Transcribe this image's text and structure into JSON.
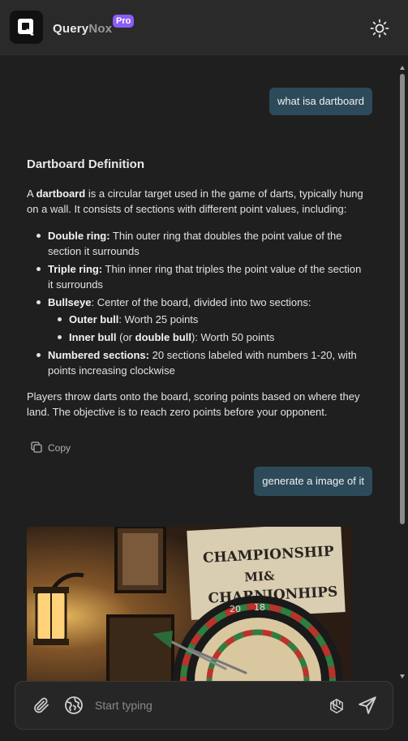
{
  "header": {
    "brand_part1": "Query",
    "brand_part2": "Nox",
    "pro_badge": "Pro",
    "logo_icon": "q-logo-icon",
    "theme_icon": "sun-icon"
  },
  "messages": [
    {
      "role": "user",
      "text": "what isa dartboard"
    },
    {
      "role": "assistant",
      "title": "Dartboard Definition",
      "intro_prefix": "A ",
      "intro_bold": "dartboard",
      "intro_rest": " is a circular target used in the game of darts, typically hung on a wall. It consists of sections with different point values, including:",
      "items": [
        {
          "bold": "Double ring:",
          "text": " Thin outer ring that doubles the point value of the section it surrounds"
        },
        {
          "bold": "Triple ring:",
          "text": " Thin inner ring that triples the point value of the section it surrounds"
        },
        {
          "bold": "Bullseye",
          "text": ": Center of the board, divided into two sections:"
        },
        {
          "bold": "Numbered sections:",
          "text": " 20 sections labeled with numbers 1-20, with points increasing clockwise"
        }
      ],
      "sub_items": [
        {
          "bold": "Outer bull",
          "text": ": Worth 25 points"
        },
        {
          "bold": "Inner bull",
          "text_a": " (or ",
          "bold_b": "double bull",
          "text_b": "): Worth 50 points"
        }
      ],
      "closing": "Players throw darts onto the board, scoring points based on where they land. The objective is to reach zero points before your opponent.",
      "copy_label": "Copy"
    },
    {
      "role": "user",
      "text": "generate a image of it"
    }
  ],
  "generated_image": {
    "sign_lines": [
      "CHAMPIONSHIP",
      "MI&",
      "CHARNIONHIPS"
    ],
    "board_numbers": [
      "20",
      "18"
    ]
  },
  "input": {
    "placeholder": "Start typing",
    "value": ""
  },
  "colors": {
    "background": "#1f1f1f",
    "header": "#2a2a2a",
    "user_bubble": "#2c4a5a",
    "pro_badge": "#8b5cf6"
  }
}
